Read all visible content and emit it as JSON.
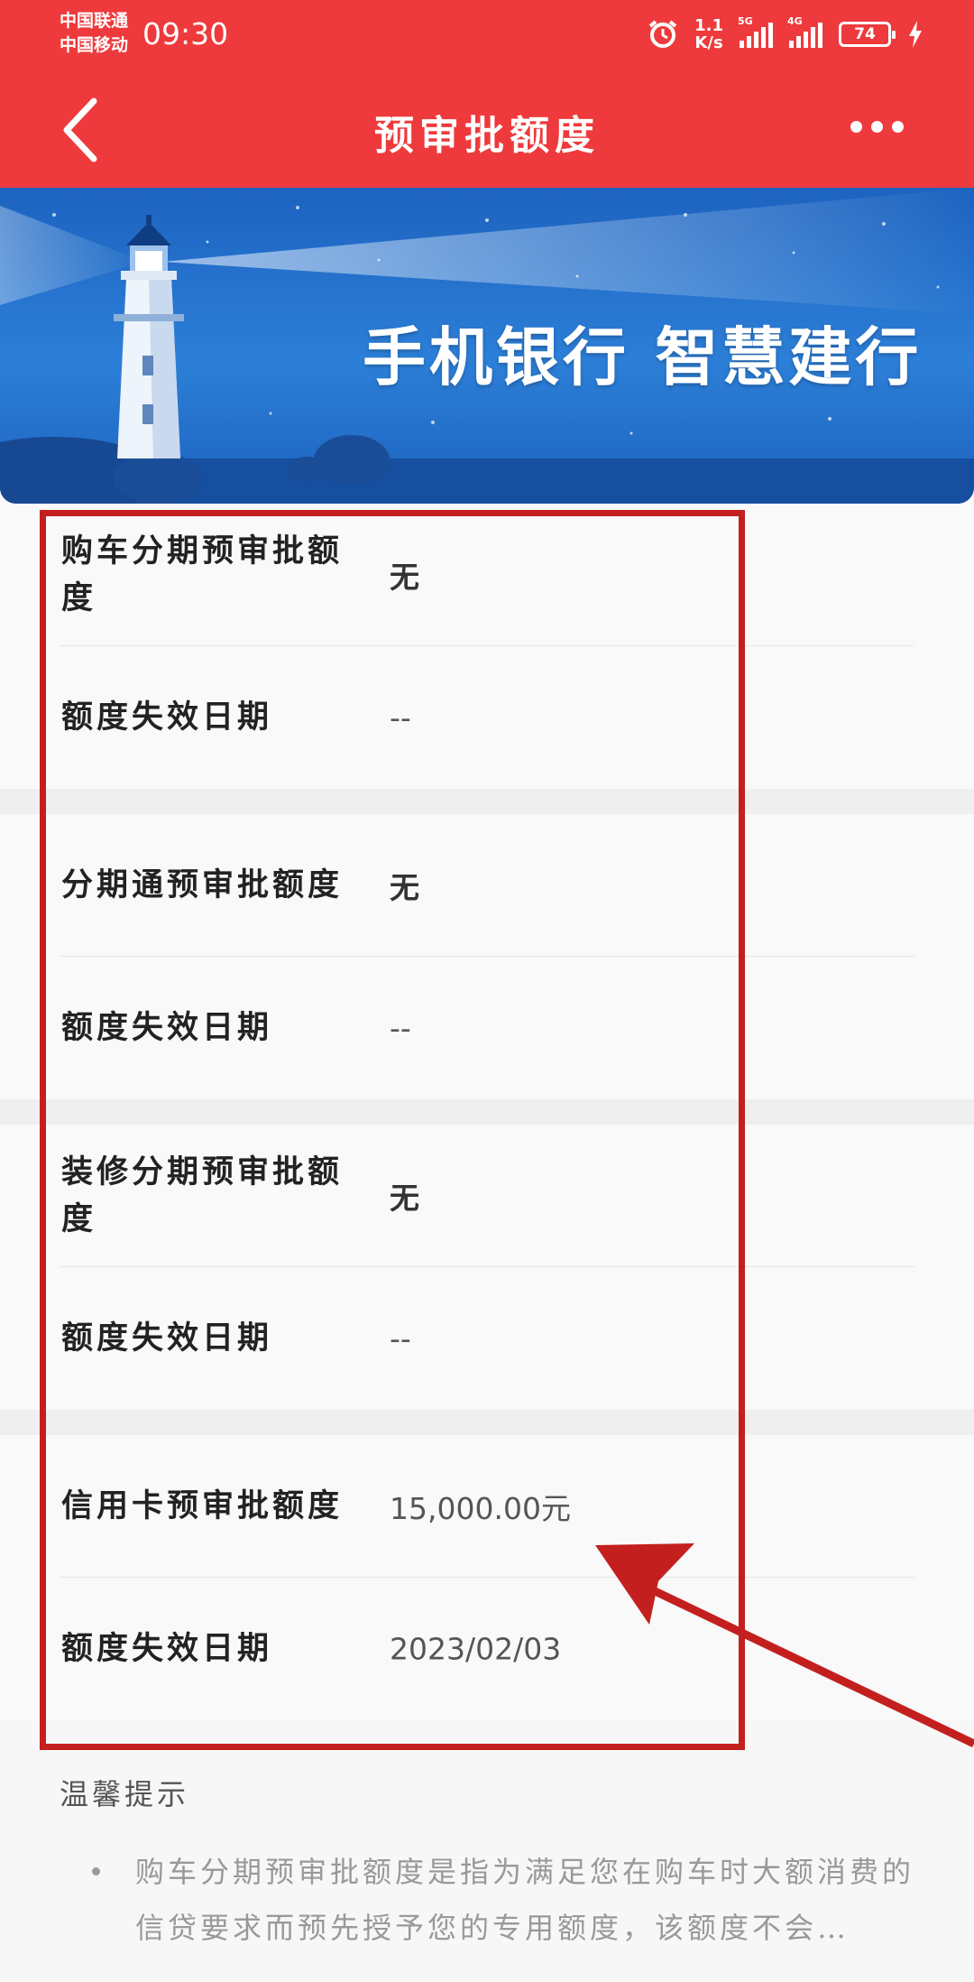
{
  "status_bar": {
    "carrier_1": "中国联通",
    "carrier_2": "中国移动",
    "time": "09:30",
    "net_speed_value": "1.1",
    "net_speed_unit": "K/s",
    "sim1_tag": "5G",
    "sim2_tag": "4G",
    "battery": "74"
  },
  "navbar": {
    "title": "预审批额度"
  },
  "banner": {
    "slogan": "手机银行  智慧建行"
  },
  "groups": [
    {
      "product_label": "购车分期预审批额度",
      "product_value": "无",
      "expiry_label": "额度失效日期",
      "expiry_value": "--"
    },
    {
      "product_label": "分期通预审批额度",
      "product_value": "无",
      "expiry_label": "额度失效日期",
      "expiry_value": "--"
    },
    {
      "product_label": "装修分期预审批额度",
      "product_value": "无",
      "expiry_label": "额度失效日期",
      "expiry_value": "--"
    },
    {
      "product_label": "信用卡预审批额度",
      "product_value": "15,000.00元",
      "expiry_label": "额度失效日期",
      "expiry_value": "2023/02/03"
    }
  ],
  "tips": {
    "title": "温馨提示",
    "item_1": "购车分期预审批额度是指为满足您在购车时大额消费的信贷要求而预先授予您的专用额度，该额度不会…"
  },
  "colors": {
    "brand_red": "#ee3a3c",
    "annotation_red": "#c41f1f",
    "banner_blue": "#1d63c0"
  }
}
